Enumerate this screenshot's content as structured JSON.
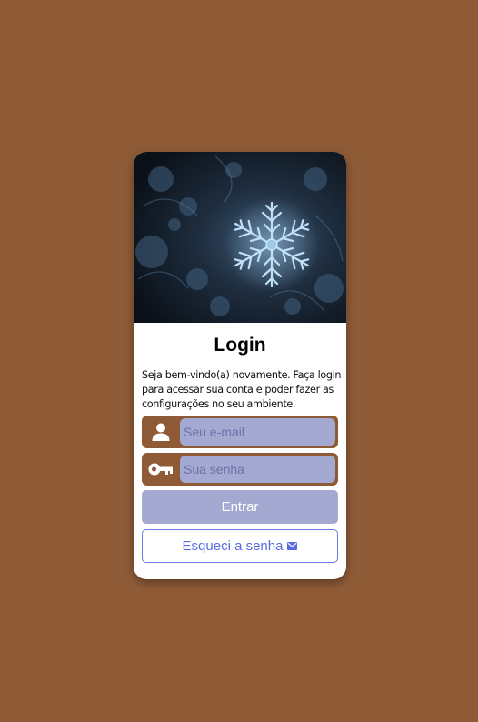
{
  "login": {
    "title": "Login",
    "description": "Seja bem-vindo(a) novamente. Faça login para acessar sua conta e poder fazer as configurações no seu ambiente.",
    "email_placeholder": "Seu e-mail",
    "password_placeholder": "Sua senha",
    "submit_label": "Entrar",
    "forgot_label": "Esqueci a senha"
  },
  "icons": {
    "email": "user-icon",
    "password": "key-icon",
    "forgot": "envelope-icon"
  },
  "colors": {
    "background": "#8f5b37",
    "card": "#ffffff",
    "input_fill": "#a3a9d1",
    "accent_outline": "#6c7be0"
  }
}
